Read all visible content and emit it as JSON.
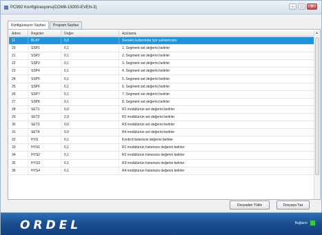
{
  "window": {
    "title": "PC992 Konfigürasyonu(COM8-19200-EVEN-3)"
  },
  "tabs": [
    {
      "label": "Konfigürasyon Sayfası"
    },
    {
      "label": "Program Sayfası"
    }
  ],
  "table": {
    "headers": [
      "Adres",
      "Register",
      "Değer",
      "Açıklama"
    ],
    "rows": [
      [
        "11",
        "BLAY",
        "0,0",
        "Sonraki kullanımlar için saklanmıştır"
      ],
      [
        "20",
        "SSP1",
        "0,1",
        "1. Segment set değerini belirler"
      ],
      [
        "21",
        "SSP2",
        "0,1",
        "2. Segment set değerini belirler"
      ],
      [
        "22",
        "SSP3",
        "0,1",
        "3. Segment set değerini belirler"
      ],
      [
        "23",
        "SSP4",
        "0,1",
        "4. Segment set değerini belirler"
      ],
      [
        "24",
        "SSP5",
        "0,1",
        "5. Segment set değerini belirler"
      ],
      [
        "25",
        "SSP6",
        "0,1",
        "6. Segment set değerini belirler"
      ],
      [
        "26",
        "SSP7",
        "0,1",
        "7. Segment set değerini belirler"
      ],
      [
        "27",
        "SSP8",
        "0,1",
        "8. Segment set değerini belirler"
      ],
      [
        "28",
        "SET1",
        "0,0",
        "R1 modülünün set değerini belirler"
      ],
      [
        "29",
        "SET2",
        "2,9",
        "R2 modülünün set değerini belirler"
      ],
      [
        "30",
        "SET3",
        "0,0",
        "R3 modülünün set değerini belirler"
      ],
      [
        "31",
        "SET4",
        "0,0",
        "R4 modülünün set değerini belirler"
      ],
      [
        "32",
        "HYS",
        "0,1",
        "Kontrol histerezis değerini belirler"
      ],
      [
        "33",
        "HYS1",
        "0,1",
        "R1 modülünün histerezis değerini belirler"
      ],
      [
        "34",
        "HYS2",
        "0,1",
        "R2 modülünün histerezis değerini belirler"
      ],
      [
        "35",
        "HYS3",
        "0,1",
        "R3 modülünün histerezis değerini belirler"
      ],
      [
        "36",
        "HYS4",
        "0,1",
        "R4 modülünün histerezis değerini belirler"
      ]
    ],
    "selected_row": 0
  },
  "buttons": {
    "load": "Dosyadan Yükle",
    "write": "Dosyaya Yaz"
  },
  "footer": {
    "logo": "ORDEL",
    "status_label": "Bağlantı",
    "status_color": "#3ec93a"
  },
  "colors": {
    "selection": "#1f93dc",
    "footer": "#1b4f92"
  }
}
